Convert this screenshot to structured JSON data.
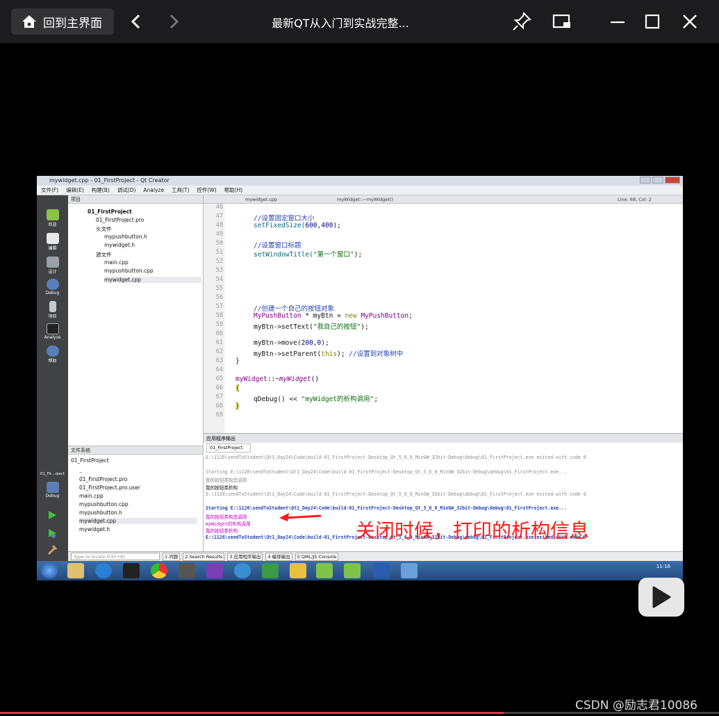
{
  "player": {
    "home_label": "回到主界面",
    "video_title": "最新QT从入门到实战完整...",
    "progress": 0.7
  },
  "qt": {
    "window_title": "mywidget.cpp - 01_FirstProject - Qt Creator",
    "menus": [
      "文件(F)",
      "编辑(E)",
      "构建(B)",
      "调试(D)",
      "Analyze",
      "工具(T)",
      "控件(W)",
      "帮助(H)"
    ],
    "modes": [
      "欢迎",
      "编辑",
      "设计",
      "Debug",
      "项目",
      "Analyze",
      "帮助"
    ],
    "project_panel_title": "项目",
    "tree": [
      {
        "label": "01_FirstProject"
      },
      {
        "label": "01_FirstProject.pro"
      },
      {
        "label": "头文件"
      },
      {
        "label": "mypushbutton.h"
      },
      {
        "label": "mywidget.h"
      },
      {
        "label": "源文件"
      },
      {
        "label": "main.cpp"
      },
      {
        "label": "mypushbutton.cpp"
      },
      {
        "label": "mywidget.cpp"
      }
    ],
    "fs_panel_title": "文件系统",
    "fs_root": "01_FirstProject",
    "fs_items": [
      "..",
      "01_FirstProject.pro",
      "01_FirstProject.pro.user",
      "main.cpp",
      "mypushbutton.cpp",
      "mypushbutton.h",
      "mywidget.cpp",
      "mywidget.h"
    ],
    "editor_file": "mywidget.cpp",
    "editor_symbol": "myWidget::~myWidget()",
    "cursor_pos": "Line: 68, Col: 2",
    "line_numbers": [
      "46",
      "47",
      "48",
      "49",
      "50",
      "51",
      "52",
      "53",
      "54",
      "55",
      "56",
      "57",
      "58",
      "59",
      "60",
      "61",
      "62",
      "63",
      "64",
      "65",
      "66",
      "67",
      "68",
      "69"
    ],
    "code": {
      "l47": "//设置固定窗口大小",
      "l48a": "setFixedSize(",
      "l48b": "600",
      "l48c": ",",
      "l48d": "400",
      "l48e": ");",
      "l50": "//设置窗口标题",
      "l51a": "setWindowTitle(",
      "l51b": "\"第一个窗口\"",
      "l51c": ");",
      "l57": "//创建一个自己的按钮对象",
      "l58a": "MyPushButton",
      "l58b": " * myBtn = ",
      "l58c": "new",
      "l58d": " MyPushButton",
      "l58e": ";",
      "l59a": "myBtn->setText(",
      "l59b": "\"我自己的按钮\"",
      "l59c": ");",
      "l61a": "myBtn->move(",
      "l61b": "200",
      "l61c": ",",
      "l61d": "0",
      "l61e": ");",
      "l62a": "myBtn->setParent(",
      "l62b": "this",
      "l62c": "); ",
      "l62d": "//设置到对象树中",
      "l63": "}",
      "l65a": "myWidget",
      "l65b": "::~",
      "l65c": "myWidget",
      "l65d": "()",
      "l66": "{",
      "l67a": "qDebug() << ",
      "l67b": "\"myWidget的析构调用\"",
      "l67c": ";",
      "l68": "}"
    },
    "output_panel_title": "应用程序输出",
    "output_tab": "01_FirstProject",
    "output_lines": [
      "E:\\1126\\sendToStudent\\Qt1_Day24\\Code\\build-01_FirstProject-Desktop_Qt_5_6_0_MinGW_32bit-Debug\\debug\\01_FirstProject.exe exited with code 0",
      "Starting E:\\1126\\sendToStudent\\Qt1_Day24\\Code\\build-01_FirstProject-Desktop_Qt_5_6_0_MinGW_32bit-Debug\\debug\\01_FirstProject.exe...",
      "我的按钮类构造调用",
      "我的按钮类析构",
      "E:\\1126\\sendToStudent\\Qt1_Day24\\Code\\build-01_FirstProject-Desktop_Qt_5_6_0_MinGW_32bit-Debug\\debug\\01_FirstProject.exe exited with code 0",
      "Starting E:\\1126\\sendToStudent\\Qt1_Day24\\Code\\build-01_FirstProject-Desktop_Qt_5_6_0_MinGW_32bit-Debug\\debug\\01_FirstProject.exe...",
      "我的按钮类构造调用",
      "myWidget的析构调用",
      "我的按钮类析构",
      "E:\\1126\\sendToStudent\\Qt1_Day24\\Code\\build-01_FirstProject-Desktop_Qt_5_6_0_MinGW_32bit-Debug\\debug\\01_FirstProject.exe exited with code 0"
    ],
    "locate_placeholder": "Type to locate (Ctrl+K)",
    "status_tabs": [
      "1 问题",
      "2 Search Results",
      "3 应用程序输出",
      "4 编译输出",
      "5 QML/JS Console"
    ],
    "kit_label": "01_Fir…oject",
    "kit_mode": "Debug",
    "clock": "11:16"
  },
  "annotation": "关闭时候，打印的析构信息",
  "watermark": "CSDN @励志君10086",
  "colors": {
    "annotation": "#ff1a1a",
    "progress": "#d73a4a",
    "qt_sidebar": "#404244"
  }
}
